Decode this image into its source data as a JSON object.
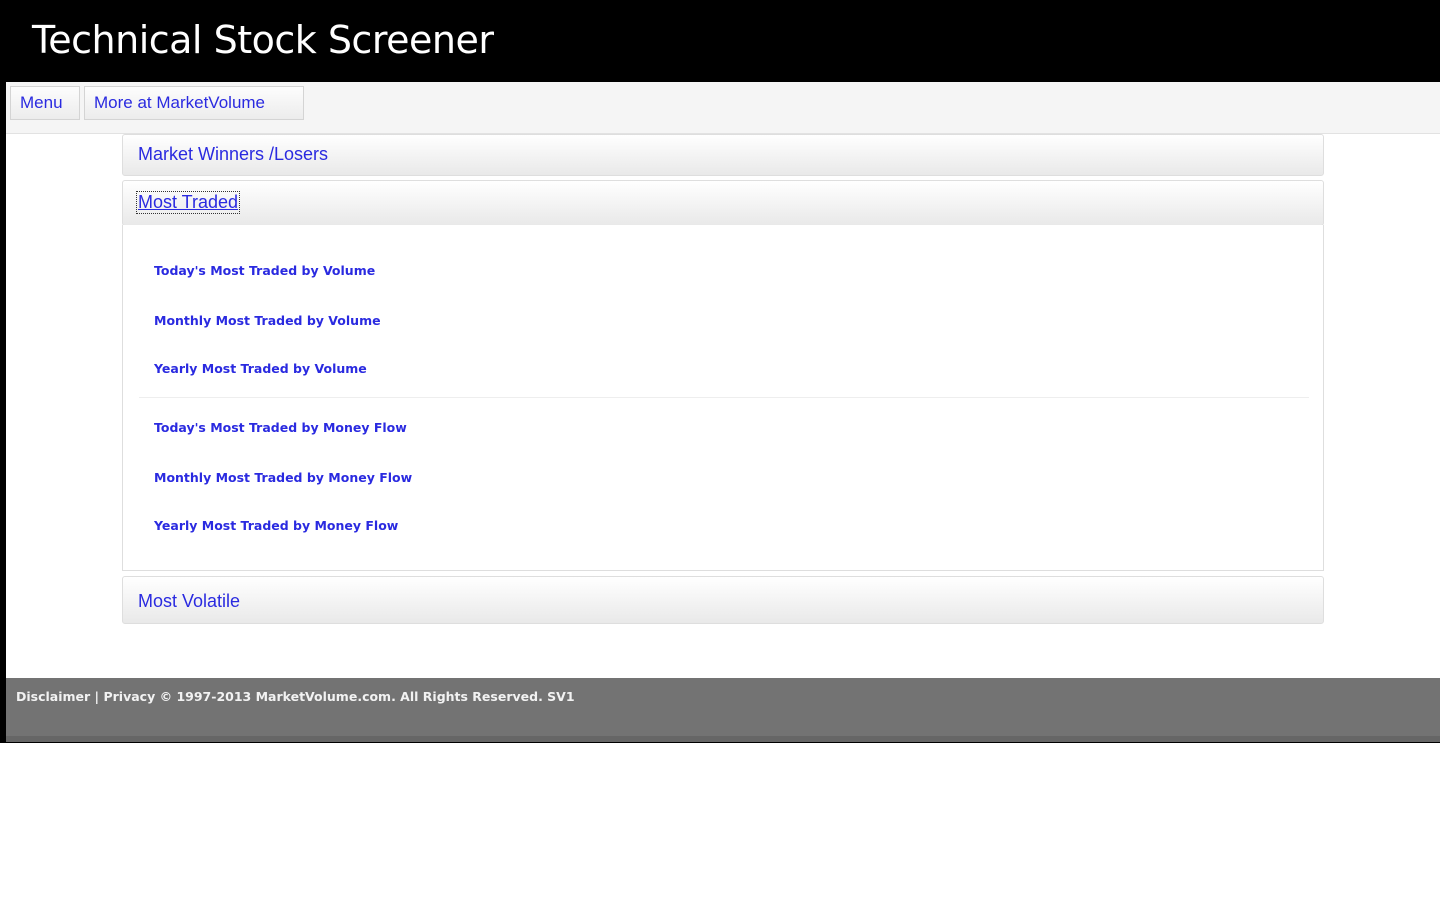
{
  "app": {
    "title": "Technical Stock Screener"
  },
  "toolbar": {
    "menu_label": "Menu",
    "more_label": "More at MarketVolume"
  },
  "accordion": {
    "sections": [
      {
        "label": "Market Winners /Losers",
        "expanded": false
      },
      {
        "label": "Most Traded",
        "expanded": true
      },
      {
        "label": "Most Volatile",
        "expanded": false
      }
    ],
    "most_traded_links": [
      "Today's Most Traded by Volume",
      "Monthly Most Traded by Volume",
      "Yearly Most Traded by Volume",
      "Today's Most Traded by Money Flow",
      "Monthly Most Traded by Money Flow",
      "Yearly Most Traded by Money Flow"
    ]
  },
  "footer": {
    "disclaimer_label": "Disclaimer",
    "separator": "|",
    "privacy_label": "Privacy",
    "copyright": "© 1997-2013 MarketVolume.com. All Rights Reserved. SV1"
  },
  "colors": {
    "link": "#2a2ae0",
    "title_bar": "#000000",
    "footer": "#737373"
  }
}
